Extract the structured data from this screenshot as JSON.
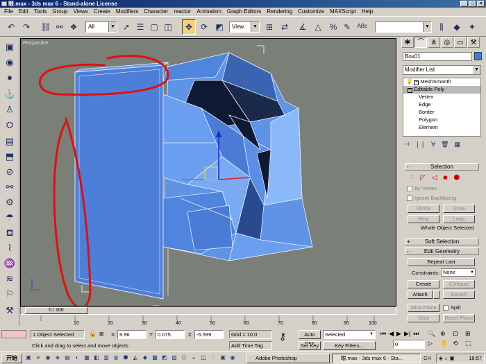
{
  "window": {
    "title": "眼.max - 3ds max 6 - Stand-alone License"
  },
  "menu": [
    "File",
    "Edit",
    "Tools",
    "Group",
    "Views",
    "Create",
    "Modifiers",
    "Character",
    "reactor",
    "Animation",
    "Graph Editors",
    "Rendering",
    "Customize",
    "MAXScript",
    "Help"
  ],
  "toolbar": {
    "selection_filter": "All",
    "ref_coord": "View"
  },
  "viewport": {
    "label": "Perspective"
  },
  "command_panel": {
    "object_name": "Box01",
    "object_color": "#3a7be0",
    "modifier_list": "Modifier List",
    "stack": [
      "MeshSmooth",
      "Editable Poly",
      "Vertex",
      "Edge",
      "Border",
      "Polygon",
      "Element"
    ],
    "rollouts": {
      "selection": "Selection",
      "by_vertex": "By Vertex",
      "ignore_backfacing": "Ignore Backfacing",
      "shrink": "Shrink",
      "grow": "Grow",
      "ring": "Ring",
      "loop": "Loop",
      "status": "Whole Object Selected",
      "soft_selection": "Soft Selection",
      "edit_geometry": "Edit Geometry",
      "repeat_last": "Repeat Last",
      "constraints_label": "Constraints:",
      "constraints_value": "None",
      "create": "Create",
      "collapse": "Collapse",
      "attach": "Attach",
      "detach": "Detach",
      "slice_plane": "Slice Plane",
      "split": "Split",
      "slice": "Slice",
      "reset_plane": "Reset Plane"
    }
  },
  "timeline": {
    "frame": "0 / 100",
    "ticks": [
      "10",
      "20",
      "30",
      "40",
      "50",
      "60",
      "70",
      "80",
      "90",
      "100"
    ]
  },
  "status": {
    "selected": "1 Object Selected",
    "prompt": "Click and drag to select and move objects",
    "x": "9.96",
    "y": "0.075",
    "z": "-6.599",
    "grid": "Grid = 10.0",
    "add_time_tag": "Add Time Tag",
    "auto_key": "Auto Key",
    "set_key": "Set Key",
    "key_mode": "Selected",
    "key_filters": "Key Filters...",
    "current_frame": "0"
  },
  "taskbar": {
    "start": "开始",
    "tasks": [
      "Adobe Photoshop",
      "眼.max - 3ds max 6 - Sta..."
    ],
    "tray": "CH",
    "time": "18:57"
  },
  "colors": {
    "poly": "#5f93e6",
    "poly_dark": "#0e1a33",
    "annotation": "#e01010",
    "viewport_bg": "#7a7f78"
  }
}
